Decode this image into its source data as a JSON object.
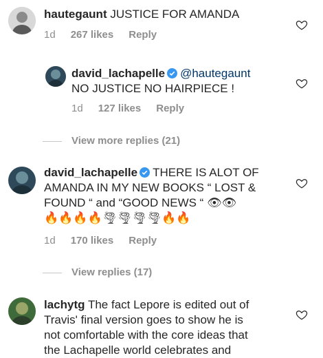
{
  "comments": [
    {
      "user": "hautegaunt",
      "text": "JUSTICE FOR AMANDA",
      "time": "1d",
      "likes": "267 likes",
      "reply": "Reply"
    },
    {
      "user": "david_lachapelle",
      "mention": "@hautegaunt",
      "text": "NO JUSTICE NO HAIRPIECE !",
      "time": "1d",
      "likes": "127 likes",
      "reply": "Reply"
    },
    {
      "user": "david_lachapelle",
      "text_line1": "THERE IS ALOT OF",
      "text_line2": "AMANDA IN MY NEW BOOKS “ LOST &",
      "text_line3": "FOUND “  and “GOOD NEWS “",
      "emoji_eyes": "👁👁",
      "emoji_row": "🔥🔥🔥🔥🌪🌪🌪🌪🔥🔥",
      "time": "1d",
      "likes": "170 likes",
      "reply": "Reply"
    },
    {
      "user": "lachytg",
      "text_line1": "The fact Lepore is edited out of",
      "text_line2": "Travis' final version goes to show he is",
      "text_line3": "not comfortable with the core ideas that",
      "text_line4": "the Lachapelle world celebrates and"
    }
  ],
  "view_more_replies": "View more replies (21)",
  "view_replies": "View replies (17)",
  "colors": {
    "text": "#262626",
    "secondary": "#8e8e8e",
    "mention": "#00376b",
    "verified": "#3897f0"
  },
  "icons": [
    "heart-icon",
    "verified-badge-icon"
  ]
}
